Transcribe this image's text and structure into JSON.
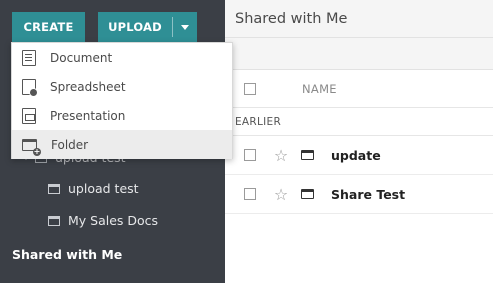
{
  "toolbar": {
    "create_label": "CREATE",
    "upload_label": "UPLOAD"
  },
  "menu": {
    "items": [
      {
        "label": "Document",
        "icon": "document-icon"
      },
      {
        "label": "Spreadsheet",
        "icon": "spreadsheet-icon"
      },
      {
        "label": "Presentation",
        "icon": "presentation-icon"
      },
      {
        "label": "Folder",
        "icon": "folder-add-icon"
      }
    ]
  },
  "sidebar": {
    "tree": [
      {
        "label": "upload test"
      },
      {
        "label": "upload test"
      },
      {
        "label": "My Sales Docs"
      }
    ],
    "shared_label": "Shared with Me"
  },
  "main": {
    "title": "Shared with Me",
    "name_column": "NAME",
    "section_label": "EARLIER",
    "rows": [
      {
        "name": "update"
      },
      {
        "name": "Share Test"
      }
    ]
  },
  "colors": {
    "sidebar_bg": "#3b3f46",
    "accent": "#2f8f95"
  }
}
